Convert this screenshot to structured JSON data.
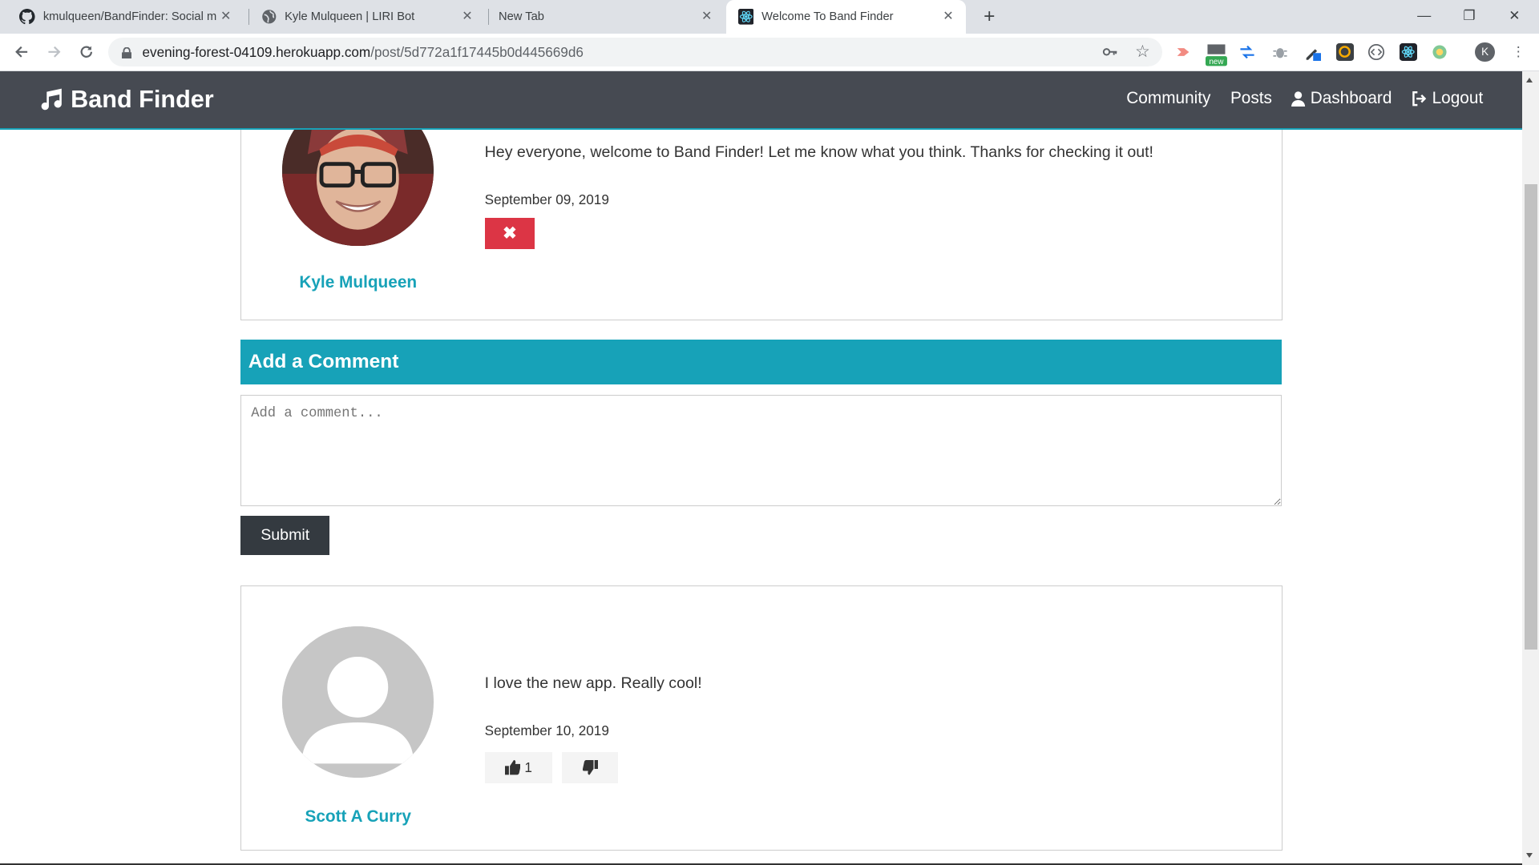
{
  "browser": {
    "tabs": [
      {
        "title": "kmulqueen/BandFinder: Social m",
        "icon": "github-icon"
      },
      {
        "title": "Kyle Mulqueen | LIRI Bot",
        "icon": "globe-icon"
      },
      {
        "title": "New Tab",
        "icon": ""
      },
      {
        "title": "Welcome To Band Finder",
        "icon": "react-icon"
      }
    ],
    "url_host": "evening-forest-04109.herokuapp.com",
    "url_path": "/post/5d772a1f17445b0d445669d6",
    "profile_initial": "K",
    "ext_badge": "new"
  },
  "navbar": {
    "brand": "Band Finder",
    "links": [
      "Community",
      "Posts",
      "Dashboard",
      "Logout"
    ]
  },
  "post": {
    "text": "Hey everyone, welcome to Band Finder! Let me know what you think. Thanks for checking it out!",
    "date": "September 09, 2019",
    "author": "Kyle Mulqueen",
    "delete_symbol": "✖"
  },
  "comment_form": {
    "heading": "Add a Comment",
    "placeholder": "Add a comment...",
    "submit_label": "Submit"
  },
  "comments": [
    {
      "text": "I love the new app. Really cool!",
      "date": "September 10, 2019",
      "author": "Scott A Curry",
      "likes": "1"
    }
  ],
  "colors": {
    "accent": "#17a2b8",
    "navbar": "#464a52",
    "danger": "#dc3545",
    "dark_button": "#343a40"
  }
}
